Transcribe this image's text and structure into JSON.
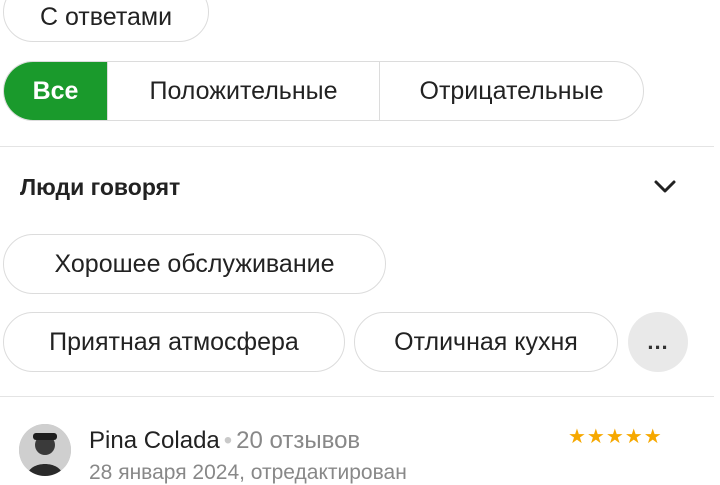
{
  "filters": {
    "with_answers": "С ответами",
    "segments": [
      "Все",
      "Положительные",
      "Отрицательные"
    ],
    "active_segment": "Все"
  },
  "people_say": {
    "title": "Люди говорят",
    "tags": [
      "Хорошее обслуживание",
      "Приятная атмосфера",
      "Отличная кухня"
    ],
    "more_label": "..."
  },
  "review": {
    "author": "Pina Colada",
    "review_count": "20 отзывов",
    "date": "28 января 2024, отредактирован",
    "rating": 5,
    "stars": "★★★★★"
  },
  "colors": {
    "accent": "#1a9a2c",
    "star": "#f6a800"
  },
  "icons": {
    "expand": "chevron-down-icon"
  }
}
